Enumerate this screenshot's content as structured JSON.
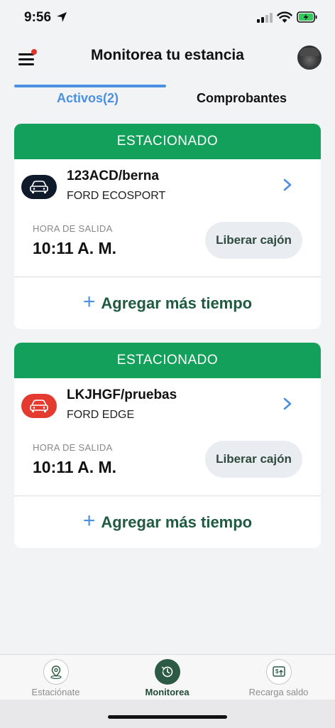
{
  "status_bar": {
    "time": "9:56"
  },
  "header": {
    "title": "Monitorea tu estancia"
  },
  "tabs": [
    {
      "label": "Activos(2)"
    },
    {
      "label": "Comprobantes"
    }
  ],
  "cards": [
    {
      "status": "ESTACIONADO",
      "plate": "123ACD/berna",
      "model": "FORD ECOSPORT",
      "badge_color": "#0f1a2a",
      "exit_label": "HORA DE SALIDA",
      "exit_time": "10:11 A. M.",
      "release_label": "Liberar cajón",
      "add_time_label": "Agregar más tiempo"
    },
    {
      "status": "ESTACIONADO",
      "plate": "LKJHGF/pruebas",
      "model": "FORD EDGE",
      "badge_color": "#e53a2f",
      "exit_label": "HORA DE SALIDA",
      "exit_time": "10:11 A. M.",
      "release_label": "Liberar cajón",
      "add_time_label": "Agregar más tiempo"
    }
  ],
  "bottom_nav": [
    {
      "label": "Estaciónate",
      "icon": "location-pin-icon"
    },
    {
      "label": "Monitorea",
      "icon": "clock-history-icon"
    },
    {
      "label": "Recarga saldo",
      "icon": "wallet-recharge-icon"
    }
  ],
  "colors": {
    "primary_green": "#12a05b",
    "accent_blue": "#4a8fe0",
    "dark_green": "#2d5a45"
  }
}
